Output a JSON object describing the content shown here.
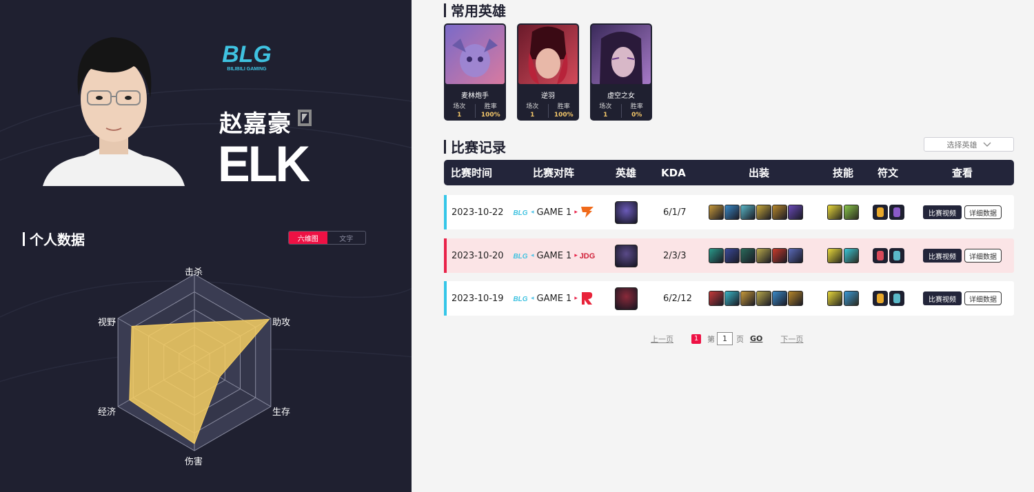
{
  "player": {
    "name": "赵嘉豪",
    "id": "ELK",
    "team_logo_text": "BLG",
    "team_logo_sub": "BILIBILI GAMING"
  },
  "stats": {
    "title": "个人数据",
    "toggle": [
      "六维图",
      "文字"
    ],
    "radar_labels": {
      "kill": "击杀",
      "assist": "助攻",
      "survive": "生存",
      "damage": "伤害",
      "economy": "经济",
      "vision": "视野"
    },
    "radar_values": {
      "kill": 0.45,
      "assist": 0.98,
      "survive": 0.33,
      "damage": 0.92,
      "economy": 0.85,
      "vision": 0.82
    }
  },
  "common_heroes": {
    "title": "常用英雄",
    "played_label": "场次",
    "winrate_label": "胜率",
    "heroes": [
      {
        "name": "麦林炮手",
        "played": "1",
        "winrate": "100%",
        "color_a": "#7a6ac8",
        "color_b": "#d87aa0"
      },
      {
        "name": "逆羽",
        "played": "1",
        "winrate": "100%",
        "color_a": "#6a1a2a",
        "color_b": "#d34a5a"
      },
      {
        "name": "虚空之女",
        "played": "1",
        "winrate": "0%",
        "color_a": "#3a2a5a",
        "color_b": "#a77ac8"
      }
    ]
  },
  "matches": {
    "title": "比赛记录",
    "select_hero": "选择英雄",
    "headers": [
      "比赛时间",
      "比赛对阵",
      "英雄",
      "KDA",
      "出装",
      "技能",
      "符文",
      "查看"
    ],
    "btn_video": "比赛视频",
    "btn_detail": "详细数据",
    "rows": [
      {
        "date": "2023-10-22",
        "game": "GAME 1",
        "opponent": "FNC",
        "kda": "6/1/7",
        "result": "win",
        "hero_color": "#6a5ab8",
        "items": [
          "#c89a3a",
          "#3a8ac8",
          "#5ab8c8",
          "#c8a83a",
          "#b8882a",
          "#6a4ab8"
        ],
        "spells": [
          "#e8d83a",
          "#8ac84a"
        ],
        "runes": [
          "#e8a82a",
          "#8a5ac8"
        ]
      },
      {
        "date": "2023-10-20",
        "game": "GAME 1",
        "opponent": "JDG",
        "kda": "2/3/3",
        "result": "loss",
        "hero_color": "#5a4a88",
        "items": [
          "#2a9a8a",
          "#3a4a9a",
          "#2a6a5a",
          "#b8a84a",
          "#c83a2a",
          "#5a6ab8"
        ],
        "spells": [
          "#e8d83a",
          "#3ac8d8"
        ],
        "runes": [
          "#d84a5a",
          "#5ab8c8"
        ]
      },
      {
        "date": "2023-10-19",
        "game": "GAME 1",
        "opponent": "R",
        "kda": "6/2/12",
        "result": "win",
        "hero_color": "#8a2a3a",
        "items": [
          "#c83a3a",
          "#3ab8c8",
          "#c89a3a",
          "#b8a84a",
          "#3a8ac8",
          "#b8882a"
        ],
        "spells": [
          "#e8d83a",
          "#3a9ad8"
        ],
        "runes": [
          "#e8a82a",
          "#5ab8c8"
        ]
      }
    ]
  },
  "pager": {
    "prev": "上一页",
    "current": "1",
    "page_prefix": "第",
    "page_value": "1",
    "page_suffix": "页",
    "go": "GO",
    "next": "下一页"
  },
  "colors": {
    "accent_red": "#ee1144",
    "win_accent": "#35c6e8",
    "loss_accent": "#e8234a",
    "dark": "#1f2030",
    "radar_fill": "#f7cf63"
  }
}
